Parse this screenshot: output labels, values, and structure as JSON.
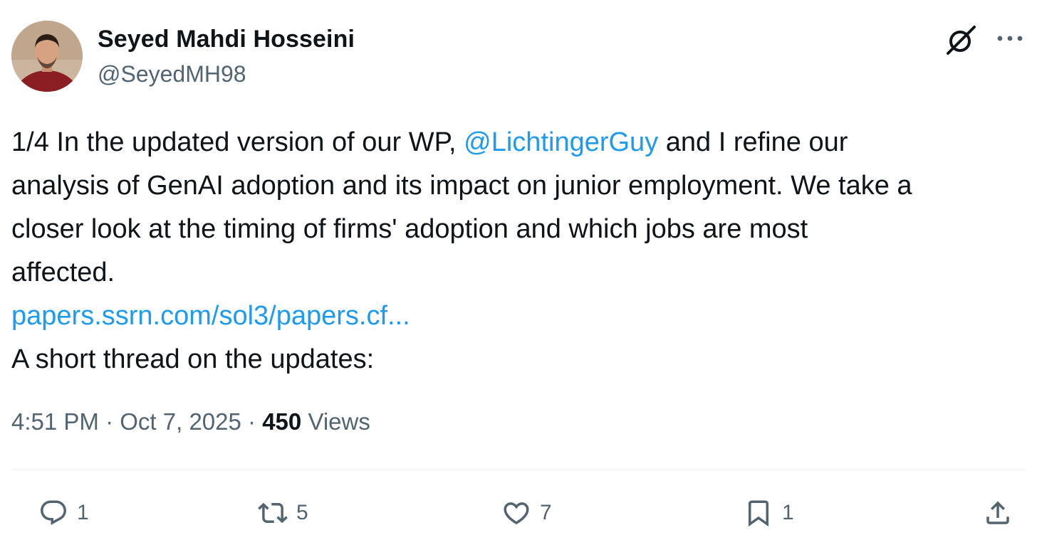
{
  "author": {
    "display_name": "Seyed Mahdi Hosseini",
    "handle": "@SeyedMH98"
  },
  "tweet": {
    "line1_pre": "1/4 In the updated version of our WP, ",
    "mention": "@LichtingerGuy",
    "line1_post": " and I refine our",
    "line2": "analysis of GenAI adoption and its impact on junior employment. We take a",
    "line3": "closer look at the timing of firms' adoption and which jobs are most",
    "line4": "affected.",
    "link": "papers.ssrn.com/sol3/papers.cf...",
    "line6": "A short thread on the updates:"
  },
  "meta": {
    "time": "4:51 PM",
    "separator": "·",
    "date": "Oct 7, 2025",
    "views_count": "450",
    "views_label": "Views"
  },
  "actions": {
    "replies": "1",
    "reposts": "5",
    "likes": "7",
    "bookmarks": "1"
  },
  "icons": {
    "header": [
      "grok-icon",
      "more-icon"
    ],
    "actions": [
      "reply-icon",
      "repost-icon",
      "like-icon",
      "bookmark-icon",
      "share-icon"
    ]
  },
  "colors": {
    "text": "#0f1419",
    "secondary": "#536471",
    "link": "#1d9bf0",
    "divider": "#eff3f4"
  }
}
